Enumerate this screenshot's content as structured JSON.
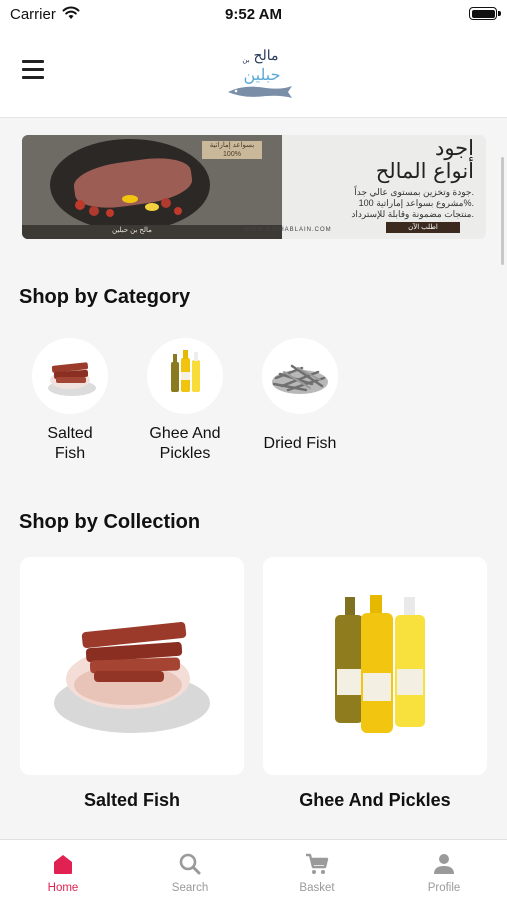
{
  "status_bar": {
    "carrier": "Carrier",
    "time": "9:52 AM"
  },
  "header": {
    "logo_text_top": "مالح",
    "logo_text_bottom": "حبلين",
    "logo_small": "بن"
  },
  "banner": {
    "title_line1": "اجود",
    "title_line2": "أنواع المالح",
    "description_lines": [
      "جودة وتخزين بمستوى عالي جداً.",
      "مشروع بسواعد إماراتية 100%.",
      "منتجات مضمونة وقابلة للإسترداد."
    ],
    "chip_text": "بسواعد إماراتية 100%",
    "strip_text": "مالح بن حبلين",
    "website": "WWW.BINHABLAIN.COM",
    "cta": "اطلب الآن"
  },
  "categories": {
    "title": "Shop by Category",
    "items": [
      {
        "label_line1": "Salted",
        "label_line2": "Fish"
      },
      {
        "label_line1": "Ghee And",
        "label_line2": "Pickles"
      },
      {
        "label_line1": "Dried Fish",
        "label_line2": ""
      }
    ]
  },
  "collections": {
    "title": "Shop by Collection",
    "items": [
      {
        "label": "Salted Fish"
      },
      {
        "label": "Ghee And Pickles"
      }
    ]
  },
  "tabbar": {
    "items": [
      {
        "label": "Home",
        "icon": "home-icon",
        "active": true
      },
      {
        "label": "Search",
        "icon": "search-icon",
        "active": false
      },
      {
        "label": "Basket",
        "icon": "cart-icon",
        "active": false
      },
      {
        "label": "Profile",
        "icon": "person-icon",
        "active": false
      }
    ]
  },
  "colors": {
    "accent": "#e02151",
    "inactive": "#9a9a9a",
    "background": "#f5f5f5"
  }
}
